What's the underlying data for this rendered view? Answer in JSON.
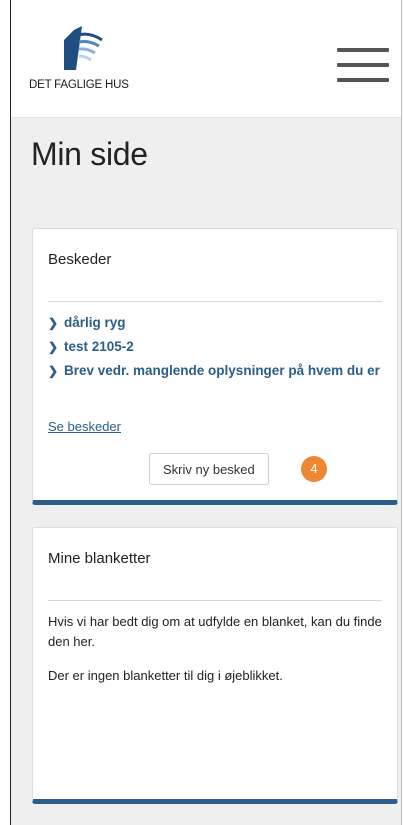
{
  "header": {
    "logo_text": "DET FAGLIGE HUS",
    "menu_icon": "hamburger-icon"
  },
  "page": {
    "title": "Min side"
  },
  "messages_card": {
    "title": "Beskeder",
    "items": [
      {
        "label": "dårlig ryg"
      },
      {
        "label": "test 2105-2"
      },
      {
        "label": "Brev vedr. manglende oplysninger på hvem du er"
      }
    ],
    "see_messages_label": "Se beskeder",
    "write_button_label": "Skriv ny besked",
    "unread_count": "4",
    "accent_color": "#2b5e8a",
    "badge_color": "#ee8733"
  },
  "forms_card": {
    "title": "Mine blanketter",
    "intro_text": "Hvis vi har bedt dig om at udfylde en blanket, kan du finde den her.",
    "empty_text": "Der er ingen blanketter til dig i øjeblikket."
  }
}
